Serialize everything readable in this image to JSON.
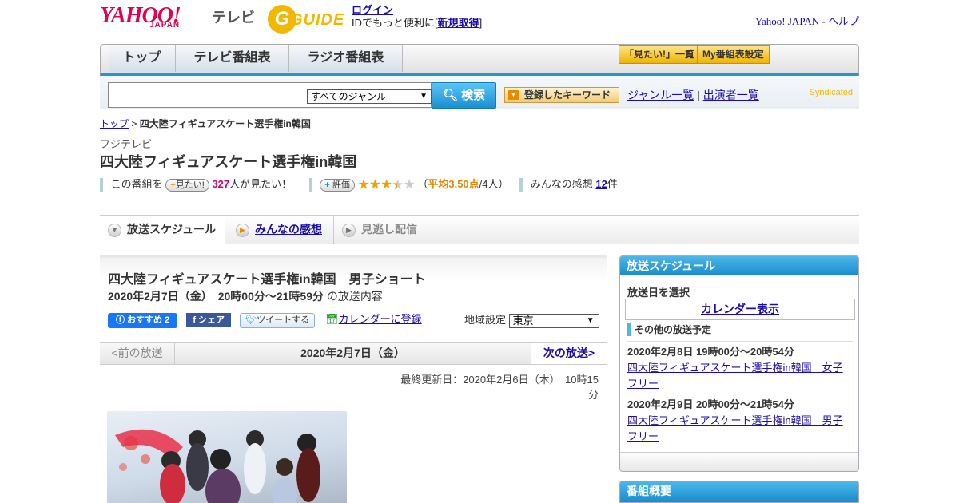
{
  "header": {
    "brand": "YAHOO!",
    "brand_sub": "JAPAN",
    "service": "テレビ",
    "guide_logo": "GUIDE",
    "login_link": "ログイン",
    "login_text_pre": "IDでもっと便利に[",
    "signup_link": "新規取得",
    "login_text_post": "]",
    "yahoo_japan_link": "Yahoo! JAPAN",
    "sep": " - ",
    "help_link": "ヘルプ"
  },
  "nav": {
    "tabs": [
      "トップ",
      "テレビ番組表",
      "ラジオ番組表"
    ],
    "want_list": "「見たい!」一覧",
    "my_settings": "My番組表設定"
  },
  "search": {
    "genre_selected": "すべてのジャンル",
    "search_button": "検索",
    "keyword_button": "登録したキーワード",
    "genre_list_link": "ジャンル一覧",
    "divider": "|",
    "cast_list_link": "出演者一覧",
    "syndicated": "Syndicated"
  },
  "breadcrumb": {
    "top": "トップ",
    "sep": " > ",
    "current": "四大陸フィギュアスケート選手権in韓国"
  },
  "program": {
    "station": "フジテレビ",
    "title": "四大陸フィギュアスケート選手権in韓国",
    "want_pre": "この番組を",
    "want_button": "見たい!",
    "want_count": "327",
    "want_post": "人が見たい！",
    "rate_button": "評価",
    "rating_open": "（",
    "rating_avg": "平均3.50点",
    "rating_count": "/4人）",
    "rating_value": 3.5,
    "impressions_label": "みんなの感想",
    "impressions_count": "12",
    "impressions_unit": "件"
  },
  "tabs": {
    "schedule": "放送スケジュール",
    "impressions": "みんなの感想",
    "missed": "見逃し配信"
  },
  "episode": {
    "title": "四大陸フィギュアスケート選手権in韓国　男子ショート",
    "datetime": "2020年2月7日（金）　20時00分～21時59分",
    "datetime_suffix": "の放送内容",
    "fb_recommend": "おすすめ 2",
    "fb_share": "シェア",
    "tweet": "ツイートする",
    "calendar": "カレンダーに登録",
    "region_label": "地域設定",
    "region_value": "東京"
  },
  "pager": {
    "prev": "<前の放送",
    "current": "2020年2月7日（金）",
    "next": "次の放送>"
  },
  "updated": "最終更新日：2020年2月6日（木）　10時15分",
  "sidebar": {
    "header": "放送スケジュール",
    "select_label": "放送日を選択",
    "calendar_button": "カレンダー表示",
    "other_label": "その他の放送予定",
    "items": [
      {
        "date": "2020年2月8日  19時00分～20時54分",
        "title": "四大陸フィギュアスケート選手権in韓国　女子フリー"
      },
      {
        "date": "2020年2月9日  20時00分～21時54分",
        "title": "四大陸フィギュアスケート選手権in韓国　男子フリー"
      }
    ],
    "summary_header": "番組概要"
  },
  "colors": {
    "accent": "#1a9ad6",
    "brand": "#e5004f",
    "star": "#f0a300",
    "pink": "#d6006f"
  }
}
